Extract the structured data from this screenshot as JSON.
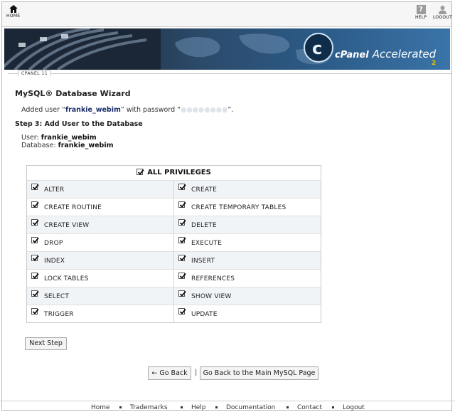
{
  "toolbar": {
    "home": "HOME",
    "help": "HELP",
    "logout": "LOGOUT"
  },
  "banner": {
    "brand": "cPanel",
    "product": "Accelerated",
    "version": "2"
  },
  "tab": {
    "label": "CPANEL 11"
  },
  "page": {
    "title": "MySQL® Database Wizard",
    "added_prefix": "Added user “",
    "added_user": "frankie_webim",
    "added_middle": "” with password “",
    "added_password": "●●●●●●●●",
    "added_suffix": "”.",
    "step": "Step 3: Add User to the Database",
    "user_label": "User:",
    "user_value": "frankie_webim",
    "db_label": "Database:",
    "db_value": "frankie_webim"
  },
  "privileges": {
    "all": "ALL PRIVILEGES",
    "items": [
      "ALTER",
      "CREATE",
      "CREATE ROUTINE",
      "CREATE TEMPORARY TABLES",
      "CREATE VIEW",
      "DELETE",
      "DROP",
      "EXECUTE",
      "INDEX",
      "INSERT",
      "LOCK TABLES",
      "REFERENCES",
      "SELECT",
      "SHOW VIEW",
      "TRIGGER",
      "UPDATE"
    ]
  },
  "buttons": {
    "next": "Next Step",
    "back": "← Go Back",
    "separator": "|",
    "main": "Go Back to the Main MySQL Page"
  },
  "footer": {
    "links": [
      "Home",
      "Trademarks",
      "Help",
      "Documentation",
      "Contact",
      "Logout"
    ]
  }
}
